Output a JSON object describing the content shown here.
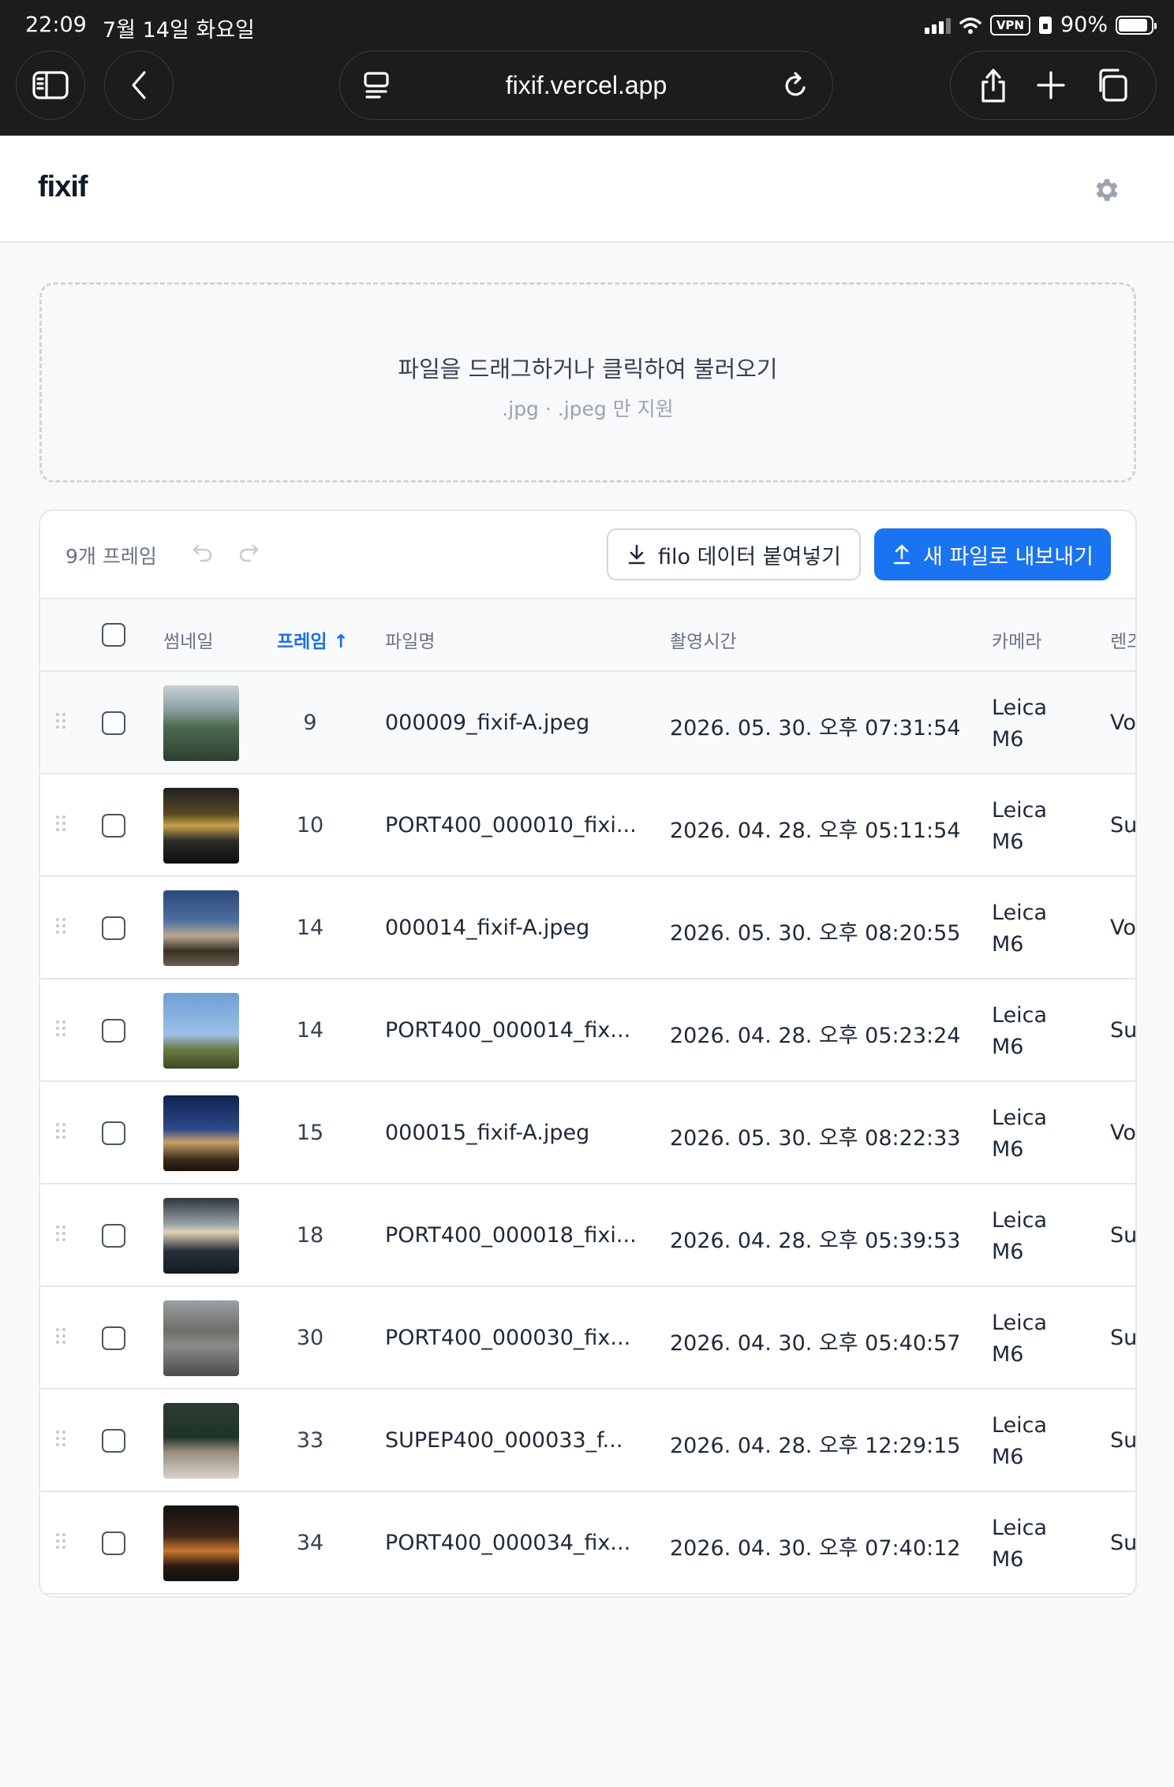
{
  "status_bar": {
    "time": "22:09",
    "date": "7월 14일 화요일",
    "vpn": "VPN",
    "battery": "90%",
    "battery_level": 0.9
  },
  "browser": {
    "url": "fixif.vercel.app",
    "icons": [
      "sidebar-icon",
      "back-icon",
      "tab-overview-icon",
      "reload-icon",
      "share-icon",
      "new-tab-icon",
      "tabs-icon"
    ]
  },
  "app": {
    "title": "fixif",
    "settings_icon": "gear-icon"
  },
  "dropzone": {
    "main_text": "파일을 드래그하거나 클릭하여 불러오기",
    "sub_text": ".jpg · .jpeg 만 지원"
  },
  "toolbar": {
    "count": "9개 프레임",
    "paste_label": "filo 데이터 붙여넣기",
    "export_label": "새 파일로 내보내기",
    "accent": "#1a73f0"
  },
  "table": {
    "headers": {
      "thumbnail": "썸네일",
      "frame": "프레임 ↑",
      "filename": "파일명",
      "datetime": "촬영시간",
      "camera": "카메라",
      "lens": "렌즈"
    },
    "rows": [
      {
        "frame": "9",
        "filename": "000009_fixif-A.jpeg",
        "datetime": "2026. 05. 30. 오후 07:31:54",
        "camera": "Leica M6",
        "lens": "Vo"
      },
      {
        "frame": "10",
        "filename": "PORT400_000010_fixi...",
        "datetime": "2026. 04. 28. 오후 05:11:54",
        "camera": "Leica M6",
        "lens": "Su"
      },
      {
        "frame": "14",
        "filename": "000014_fixif-A.jpeg",
        "datetime": "2026. 05. 30. 오후 08:20:55",
        "camera": "Leica M6",
        "lens": "Vo"
      },
      {
        "frame": "14",
        "filename": "PORT400_000014_fix...",
        "datetime": "2026. 04. 28. 오후 05:23:24",
        "camera": "Leica M6",
        "lens": "Su"
      },
      {
        "frame": "15",
        "filename": "000015_fixif-A.jpeg",
        "datetime": "2026. 05. 30. 오후 08:22:33",
        "camera": "Leica M6",
        "lens": "Vo"
      },
      {
        "frame": "18",
        "filename": "PORT400_000018_fixi...",
        "datetime": "2026. 04. 28. 오후 05:39:53",
        "camera": "Leica M6",
        "lens": "Su"
      },
      {
        "frame": "30",
        "filename": "PORT400_000030_fix...",
        "datetime": "2026. 04. 30. 오후 05:40:57",
        "camera": "Leica M6",
        "lens": "Su"
      },
      {
        "frame": "33",
        "filename": "SUPEP400_000033_f...",
        "datetime": "2026. 04. 28. 오후 12:29:15",
        "camera": "Leica M6",
        "lens": "Su"
      },
      {
        "frame": "34",
        "filename": "PORT400_000034_fix...",
        "datetime": "2026. 04. 30. 오후 07:40:12",
        "camera": "Leica M6",
        "lens": "Su"
      }
    ]
  }
}
